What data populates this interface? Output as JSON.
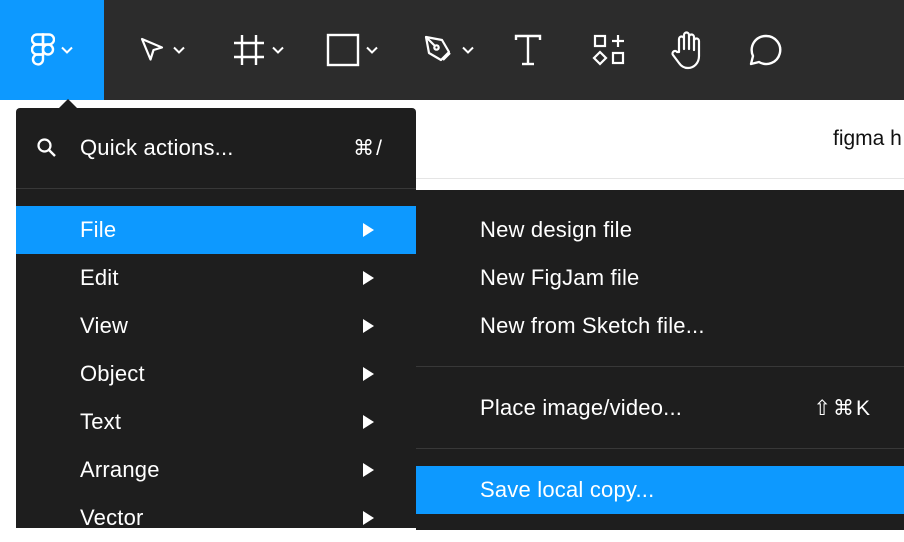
{
  "toolbar": {
    "tools": [
      {
        "name": "figma-menu",
        "icon": "figma-logo-icon"
      },
      {
        "name": "move-tool",
        "icon": "cursor-arrow-icon"
      },
      {
        "name": "frame-tool",
        "icon": "frame-hash-icon"
      },
      {
        "name": "shape-tool",
        "icon": "rectangle-icon"
      },
      {
        "name": "pen-tool",
        "icon": "pen-nib-icon"
      },
      {
        "name": "text-tool",
        "icon": "text-t-icon"
      },
      {
        "name": "resources-tool",
        "icon": "resources-icon"
      },
      {
        "name": "hand-tool",
        "icon": "hand-icon"
      },
      {
        "name": "comment-tool",
        "icon": "comment-bubble-icon"
      }
    ],
    "accent_color": "#0d99ff"
  },
  "canvas": {
    "title": "figma h"
  },
  "main_menu": {
    "quick_actions": {
      "label": "Quick actions...",
      "shortcut": "⌘/"
    },
    "items": [
      {
        "label": "File",
        "active": true
      },
      {
        "label": "Edit"
      },
      {
        "label": "View"
      },
      {
        "label": "Object"
      },
      {
        "label": "Text"
      },
      {
        "label": "Arrange"
      },
      {
        "label": "Vector"
      }
    ]
  },
  "file_submenu": {
    "items": [
      {
        "label": "New design file"
      },
      {
        "label": "New FigJam file"
      },
      {
        "label": "New from Sketch file..."
      },
      {
        "label": "Place image/video...",
        "shortcut": "⇧⌘K"
      },
      {
        "label": "Save local copy...",
        "active": true
      }
    ]
  }
}
